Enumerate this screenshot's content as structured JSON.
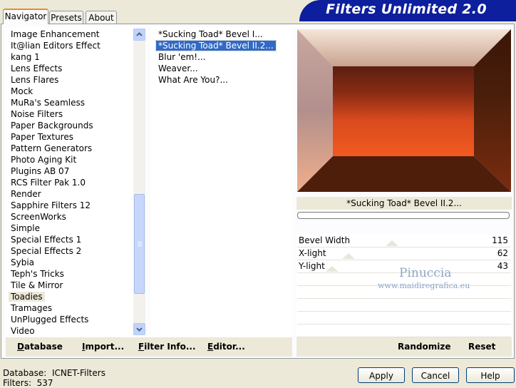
{
  "banner": {
    "title": "Filters Unlimited 2.0"
  },
  "tabs": [
    {
      "label": "Navigator"
    },
    {
      "label": "Presets"
    },
    {
      "label": "About"
    }
  ],
  "categories": [
    "Image Enhancement",
    "It@lian Editors Effect",
    "kang 1",
    "Lens Effects",
    "Lens Flares",
    "Mock",
    "MuRa's Seamless",
    "Noise Filters",
    "Paper Backgrounds",
    "Paper Textures",
    "Pattern Generators",
    "Photo Aging Kit",
    "Plugins AB 07",
    "RCS Filter Pak 1.0",
    "Render",
    "Sapphire Filters 12",
    "ScreenWorks",
    "Simple",
    "Special Effects 1",
    "Special Effects 2",
    "Sybia",
    "Teph's Tricks",
    "Tile & Mirror",
    "Toadies",
    "Tramages",
    "UnPlugged Effects",
    "Video"
  ],
  "selected_category": "Toadies",
  "filters": [
    "*Sucking Toad*  Bevel I...",
    "*Sucking Toad*  Bevel II.2...",
    "Blur 'em!...",
    "Weaver...",
    "What Are You?..."
  ],
  "selected_filter": "*Sucking Toad*  Bevel II.2...",
  "preview_caption": "*Sucking Toad*  Bevel II.2...",
  "params": [
    {
      "label": "Bevel Width",
      "value": "115"
    },
    {
      "label": "X-light",
      "value": "62"
    },
    {
      "label": "Y-light",
      "value": "43"
    }
  ],
  "watermark": {
    "line1": "Pinuccia",
    "line2": "www.maidiregrafica.eu"
  },
  "toolbar": {
    "database": "Database",
    "import": "Import...",
    "filter_info": "Filter Info...",
    "editor": "Editor...",
    "randomize": "Randomize",
    "reset": "Reset"
  },
  "status": {
    "database_label": "Database:",
    "database_value": "ICNET-Filters",
    "filters_label": "Filters:",
    "filters_value": "537"
  },
  "buttons": {
    "apply": "Apply",
    "cancel": "Cancel",
    "help": "Help"
  }
}
